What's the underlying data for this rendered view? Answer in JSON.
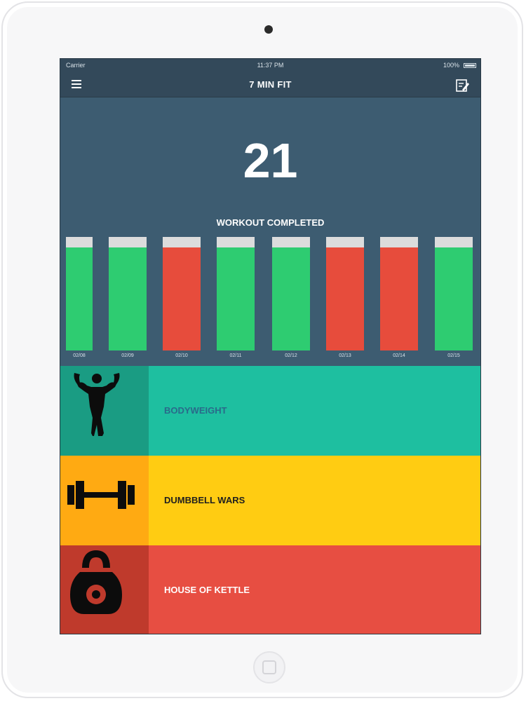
{
  "status_bar": {
    "carrier": "Carrier",
    "time": "11:37 PM",
    "battery": "100%"
  },
  "nav": {
    "title": "7 MIN FIT",
    "menu_icon": "hamburger-menu-icon",
    "edit_icon": "compose-icon"
  },
  "summary": {
    "workout_count": "21",
    "label": "WORKOUT COMPLETED"
  },
  "chart_data": {
    "type": "bar",
    "categories": [
      "02/08",
      "02/09",
      "02/10",
      "02/11",
      "02/12",
      "02/13",
      "02/14",
      "02/15"
    ],
    "status": [
      "completed",
      "completed",
      "missed",
      "completed",
      "completed",
      "missed",
      "missed",
      "completed"
    ],
    "colors": {
      "completed": "#2ecc71",
      "missed": "#e74c3c",
      "cap": "#dcdcdc"
    }
  },
  "categories": [
    {
      "label": "BODYWEIGHT",
      "icon": "bodybuilder-icon"
    },
    {
      "label": "DUMBBELL WARS",
      "icon": "dumbbell-icon"
    },
    {
      "label": "HOUSE OF KETTLE",
      "icon": "kettlebell-icon"
    }
  ]
}
